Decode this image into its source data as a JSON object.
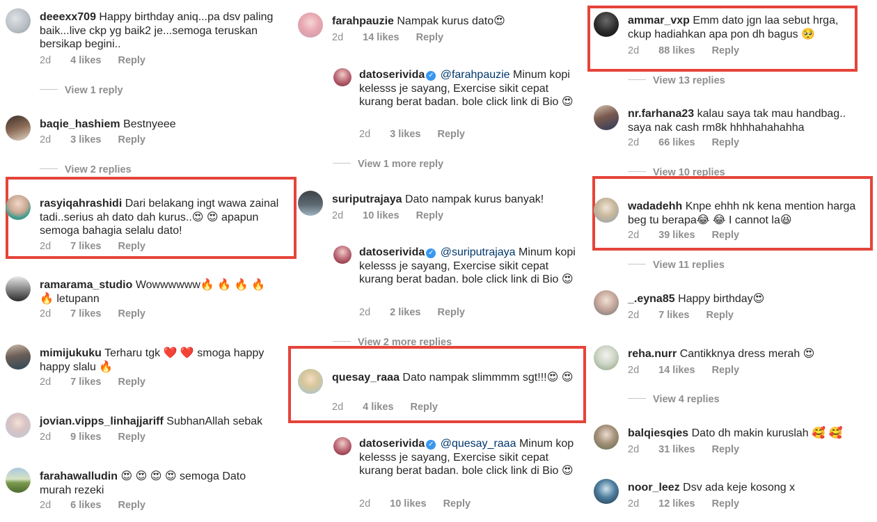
{
  "colors": {
    "highlight": "#e5443a",
    "verified": "#3897f0",
    "mention": "#00376b",
    "meta": "#8e8e8e"
  },
  "icons": {
    "verified": "verified-badge-icon"
  },
  "columns": [
    {
      "comments": [
        {
          "user": "deeexx709",
          "text": "Happy birthday aniq...pa dsv paling baik...live ckp yg baik2 je...semoga teruskan bersikap begini..",
          "time": "2d",
          "likes": "4 likes",
          "reply": "Reply",
          "view_replies": "View 1 reply"
        },
        {
          "user": "baqie_hashiem",
          "text": "Bestnyeee",
          "time": "2d",
          "likes": "3 likes",
          "reply": "Reply",
          "view_replies": "View 2 replies"
        },
        {
          "user": "rasyiqahrashidi",
          "text": "Dari belakang ingt wawa zainal tadi..serius ah dato dah kurus..😍 😍  apapun semoga bahagia selalu dato!",
          "time": "2d",
          "likes": "7 likes",
          "reply": "Reply"
        },
        {
          "user": "ramarama_studio",
          "text": "Wowwwwww🔥 🔥 🔥 🔥 🔥 letupann",
          "time": "2d",
          "likes": "7 likes",
          "reply": "Reply"
        },
        {
          "user": "mimijukuku",
          "text": "Terharu tgk ❤️ ❤️  smoga happy happy slalu 🔥",
          "time": "2d",
          "likes": "7 likes",
          "reply": "Reply"
        },
        {
          "user": "jovian.vipps_linhajjariff",
          "text": "SubhanAllah sebak",
          "time": "2d",
          "likes": "9 likes",
          "reply": "Reply"
        },
        {
          "user": "farahawalludin",
          "text": "😍 😍 😍 😍  semoga Dato murah rezeki",
          "time": "2d",
          "likes": "6 likes",
          "reply": "Reply"
        }
      ]
    },
    {
      "comments": [
        {
          "user": "farahpauzie",
          "text": "Nampak kurus dato😍",
          "time": "2d",
          "likes": "14 likes",
          "reply": "Reply"
        },
        {
          "user": "datoserivida",
          "mention": "@farahpauzie",
          "text": "Minum kopi kelesss je sayang, Exercise sikit cepat kurang berat badan. bole click link di Bio 😍",
          "time": "2d",
          "likes": "3 likes",
          "reply": "Reply",
          "view_replies": "View 1 more reply"
        },
        {
          "user": "suriputrajaya",
          "text": "Dato nampak kurus banyak!",
          "time": "2d",
          "likes": "10 likes",
          "reply": "Reply"
        },
        {
          "user": "datoserivida",
          "mention": "@suriputrajaya",
          "text": "Minum kopi kelesss je sayang, Exercise sikit cepat kurang berat badan. bole click link di Bio 😍",
          "time": "2d",
          "likes": "2 likes",
          "reply": "Reply",
          "view_replies": "View 2 more replies"
        },
        {
          "user": "quesay_raaa",
          "text": "Dato nampak slimmmm sgt!!!😍 😍",
          "time": "2d",
          "likes": "4 likes",
          "reply": "Reply"
        },
        {
          "user": "datoserivida",
          "mention": "@quesay_raaa",
          "text": "Minum kop kelesss je sayang, Exercise sikit cepat kurang berat badan. bole click link di Bio 😍",
          "time": "2d",
          "likes": "10 likes",
          "reply": "Reply"
        }
      ]
    },
    {
      "comments": [
        {
          "user": "ammar_vxp",
          "text": "Emm dato jgn laa sebut hrga, ckup hadiahkan apa pon dh bagus 🥺",
          "time": "2d",
          "likes": "88 likes",
          "reply": "Reply",
          "view_replies": "View 13 replies"
        },
        {
          "user": "nr.farhana23",
          "text": "kalau saya tak mau handbag.. saya nak cash rm8k hhhhahahahha",
          "time": "2d",
          "likes": "66 likes",
          "reply": "Reply",
          "view_replies": "View 10 replies"
        },
        {
          "user": "wadadehh",
          "text": "Knpe ehhh nk kena mention harga beg tu berapa😂 😂 I cannot la😆",
          "time": "2d",
          "likes": "39 likes",
          "reply": "Reply",
          "view_replies": "View 11 replies"
        },
        {
          "user": "_.eyna85",
          "text": "Happy birthday😍",
          "time": "2d",
          "likes": "7 likes",
          "reply": "Reply"
        },
        {
          "user": "reha.nurr",
          "text": "Cantikknya dress merah 😍",
          "time": "2d",
          "likes": "14 likes",
          "reply": "Reply",
          "view_replies": "View 4 replies"
        },
        {
          "user": "balqiesqies",
          "text": "Dato dh makin kuruslah 🥰 🥰",
          "time": "2d",
          "likes": "31 likes",
          "reply": "Reply"
        },
        {
          "user": "noor_leez",
          "text": "Dsv ada keje kosong x",
          "time": "2d",
          "likes": "12 likes",
          "reply": "Reply"
        }
      ]
    }
  ]
}
